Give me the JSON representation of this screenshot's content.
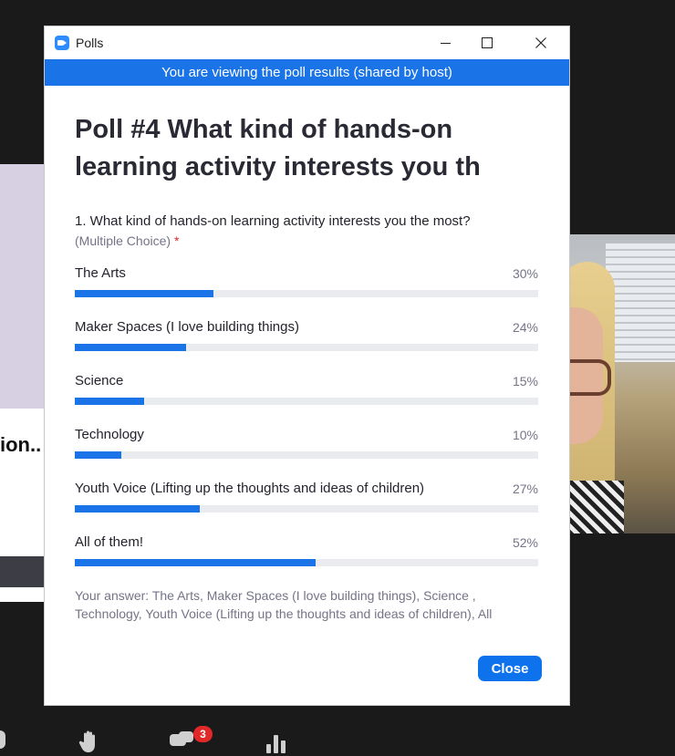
{
  "background": {
    "slide_fragment": "ion.."
  },
  "window": {
    "title": "Polls"
  },
  "banner": "You are viewing the poll results (shared by host)",
  "poll": {
    "title": "Poll #4 What kind of hands-on learning activity interests you th",
    "question": "1. What kind of hands-on learning activity interests you the most?",
    "question_type": "(Multiple Choice)",
    "required_marker": "*",
    "options": [
      {
        "label": "The Arts",
        "percent": "30%",
        "value": 0.3
      },
      {
        "label": "Maker Spaces (I love building things)",
        "percent": "24%",
        "value": 0.24
      },
      {
        "label": "Science",
        "percent": "15%",
        "value": 0.15
      },
      {
        "label": "Technology",
        "percent": "10%",
        "value": 0.1
      },
      {
        "label": "Youth Voice (Lifting up the thoughts and ideas of children)",
        "percent": "27%",
        "value": 0.27
      },
      {
        "label": "All of them!",
        "percent": "52%",
        "value": 0.52
      }
    ],
    "your_answer": "Your answer: The Arts, Maker Spaces (I love building things), Science , Technology, Youth Voice (Lifting up the thoughts and ideas of children), All"
  },
  "buttons": {
    "close": "Close"
  },
  "toolbar": {
    "chat_badge": "3"
  },
  "colors": {
    "accent": "#1a74e8",
    "track": "#e9ebef",
    "required": "#e02828"
  }
}
